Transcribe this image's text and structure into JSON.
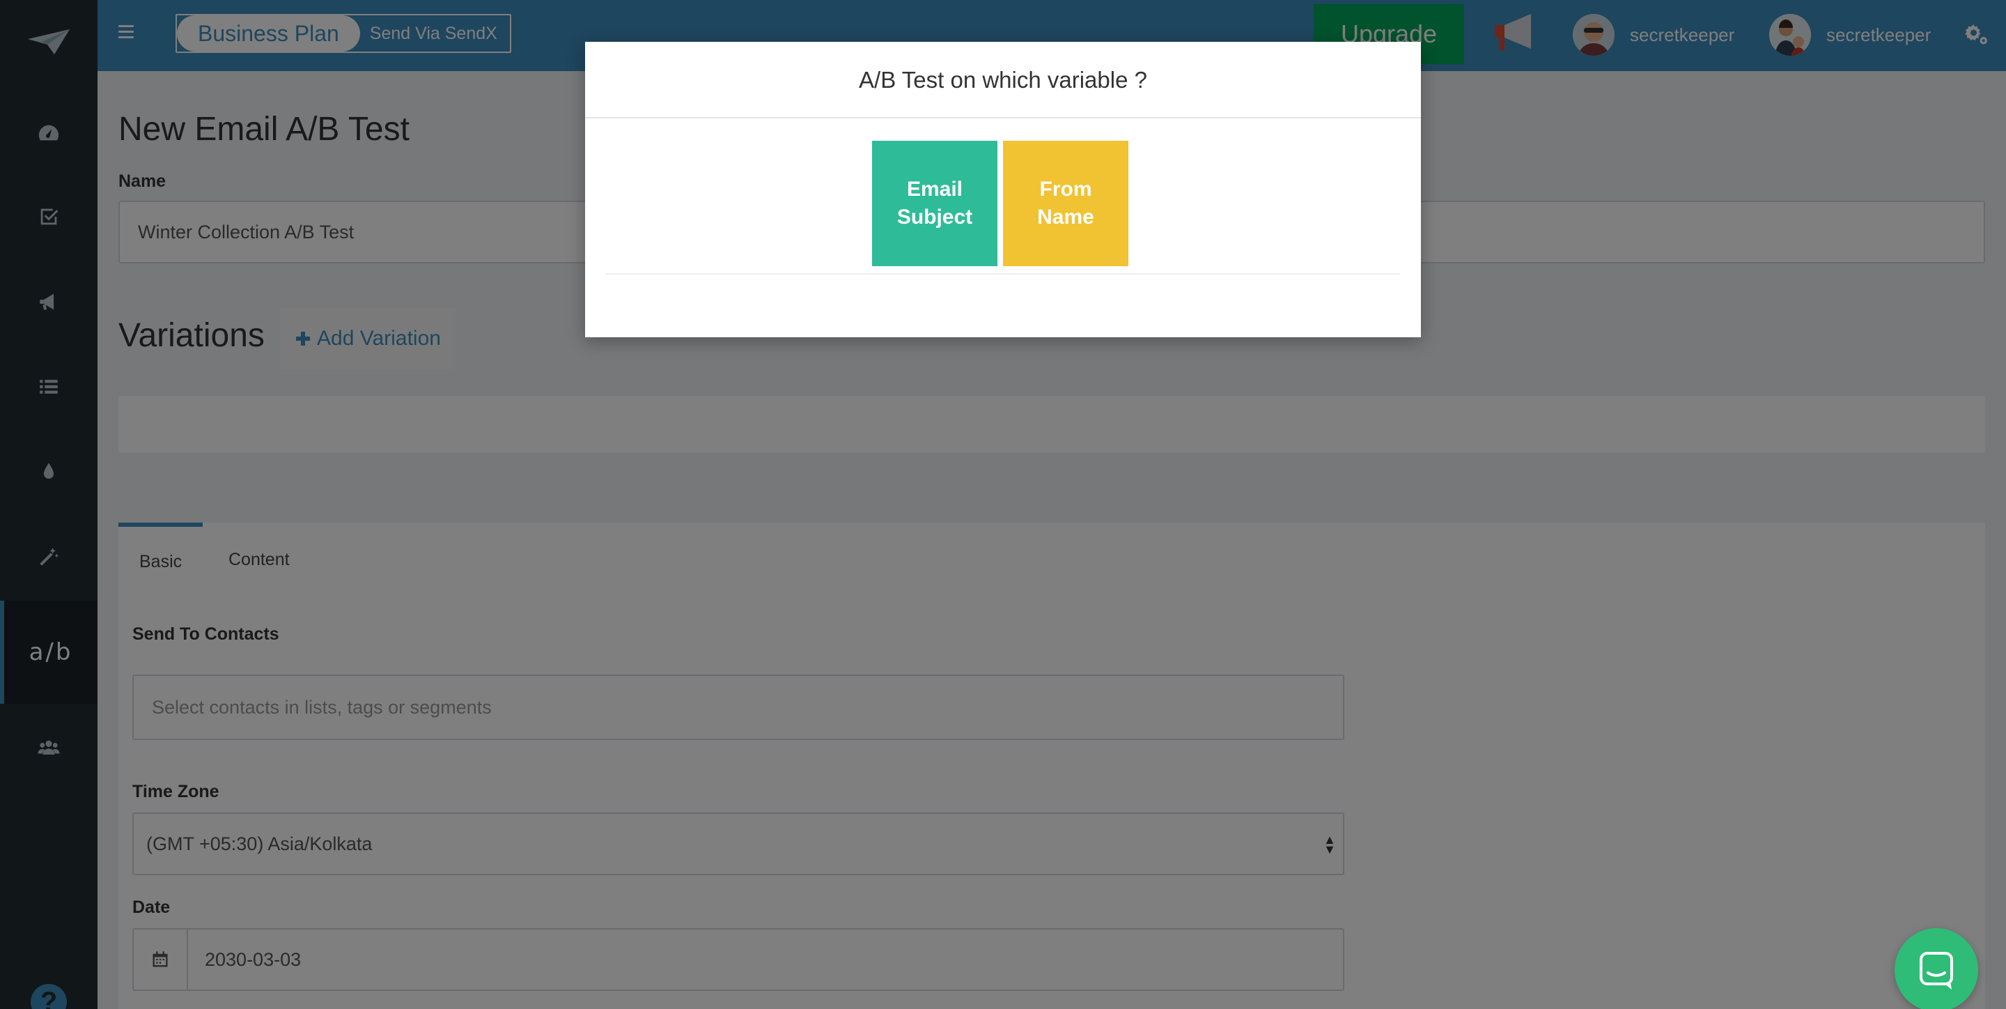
{
  "header": {
    "plan_name": "Business Plan",
    "plan_link": "Send Via SendX",
    "upgrade_label": "Upgrade",
    "user1_name": "secretkeeper",
    "user2_name": "secretkeeper"
  },
  "sidebar": {
    "ab_label": "a/b",
    "help_label": "?"
  },
  "page": {
    "title": "New Email A/B Test",
    "name_label": "Name",
    "name_value": "Winter Collection A/B Test",
    "variations_title": "Variations",
    "add_variation_label": "Add Variation",
    "tabs": [
      {
        "label": "Basic"
      },
      {
        "label": "Content"
      }
    ],
    "send_to_label": "Send To Contacts",
    "send_to_placeholder": "Select contacts in lists, tags or segments",
    "timezone_label": "Time Zone",
    "timezone_value": "(GMT +05:30) Asia/Kolkata",
    "date_label": "Date",
    "date_value": "2030-03-03"
  },
  "modal": {
    "title": "A/B Test on which variable ?",
    "option1_line1": "Email",
    "option1_line2": "Subject",
    "option2_line1": "From",
    "option2_line2": "Name"
  },
  "colors": {
    "header": "#3c8dbc",
    "sidebar": "#222d32",
    "upgrade": "#00a65a",
    "email_subject_option": "#2ebc98",
    "from_name_option": "#f1c232",
    "chat": "#2ebc77"
  }
}
